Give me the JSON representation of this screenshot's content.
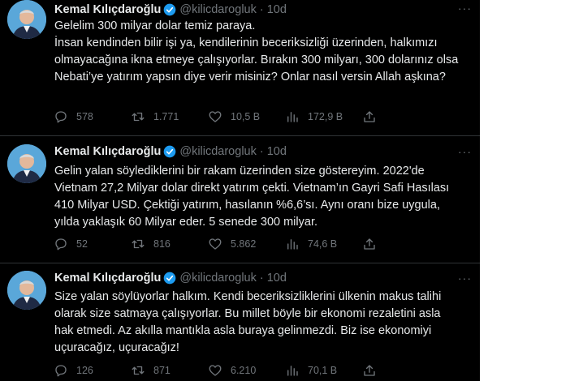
{
  "colors": {
    "background": "#000000",
    "text": "#e7e9ea",
    "muted": "#71767b",
    "verified": "#1d9bf0",
    "divider": "#2f3336"
  },
  "tweets": [
    {
      "author": "Kemal Kılıçdaroğlu",
      "handle": "@kilicdarogluk",
      "separator": "·",
      "time": "10d",
      "more": "···",
      "text": "Gelelim 300 milyar dolar temiz paraya.\nİnsan kendinden bilir işi ya, kendilerinin beceriksizliği üzerinden, halkımızı olmayacağına ikna etmeye çalışıyorlar. Bırakın 300 milyarı, 300 dolarınız olsa Nebati’ye yatırım yapsın diye verir misiniz? Onlar nasıl versin Allah aşkına?",
      "replies": "578",
      "retweets": "1.771",
      "likes": "10,5 B",
      "views": "172,9 B",
      "icons": [
        "reply-icon",
        "retweet-icon",
        "like-icon",
        "views-icon",
        "share-icon"
      ]
    },
    {
      "author": "Kemal Kılıçdaroğlu",
      "handle": "@kilicdarogluk",
      "separator": "·",
      "time": "10d",
      "more": "···",
      "text": "Gelin yalan söylediklerini bir rakam üzerinden size göstereyim. 2022'de Vietnam 27,2 Milyar dolar direkt yatırım çekti. Vietnam’ın Gayri Safi Hasılası 410 Milyar USD. Çektiği yatırım, hasılanın %6,6’sı. Aynı oranı bize uygula, yılda yaklaşık 60 Milyar eder. 5 senede 300 milyar.",
      "replies": "52",
      "retweets": "816",
      "likes": "5.862",
      "views": "74,6 B",
      "icons": [
        "reply-icon",
        "retweet-icon",
        "like-icon",
        "views-icon",
        "share-icon"
      ]
    },
    {
      "author": "Kemal Kılıçdaroğlu",
      "handle": "@kilicdarogluk",
      "separator": "·",
      "time": "10d",
      "more": "···",
      "text": "Size yalan söylüyorlar halkım. Kendi beceriksizliklerini ülkenin makus talihi olarak size satmaya çalışıyorlar. Bu millet böyle bir ekonomi rezaletini asla hak etmedi. Az akılla mantıkla asla buraya gelinmezdi. Biz ise ekonomiyi uçuracağız, uçuracağız!",
      "replies": "126",
      "retweets": "871",
      "likes": "6.210",
      "views": "70,1 B",
      "icons": [
        "reply-icon",
        "retweet-icon",
        "like-icon",
        "views-icon",
        "share-icon"
      ]
    }
  ]
}
